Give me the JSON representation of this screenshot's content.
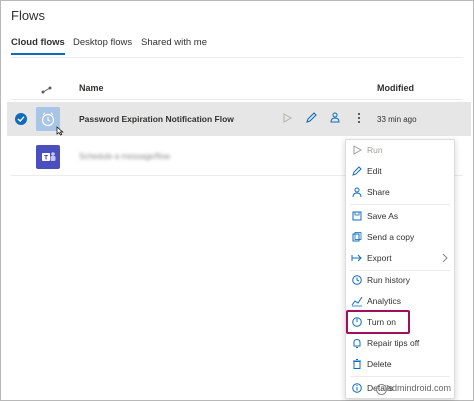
{
  "page": {
    "title": "Flows"
  },
  "tabs": [
    {
      "label": "Cloud flows",
      "active": true
    },
    {
      "label": "Desktop flows",
      "active": false
    },
    {
      "label": "Shared with me",
      "active": false
    }
  ],
  "table": {
    "headers": {
      "type_icon": "flow-type-icon",
      "name": "Name",
      "modified": "Modified"
    },
    "rows": [
      {
        "name": "Password Expiration Notification Flow",
        "modified": "33 min ago",
        "selected": true,
        "icon": "alarm-clock-icon"
      },
      {
        "name": "Schedule a message/flow",
        "modified": "",
        "selected": false,
        "icon": "teams-icon"
      }
    ]
  },
  "menu": {
    "items": [
      {
        "label": "Run",
        "icon": "play-icon",
        "disabled": true
      },
      {
        "label": "Edit",
        "icon": "pencil-icon"
      },
      {
        "label": "Share",
        "icon": "share-icon"
      },
      {
        "label": "Save As",
        "icon": "save-as-icon"
      },
      {
        "label": "Send a copy",
        "icon": "send-copy-icon"
      },
      {
        "label": "Export",
        "icon": "export-icon",
        "submenu": true
      },
      {
        "label": "Run history",
        "icon": "history-icon"
      },
      {
        "label": "Analytics",
        "icon": "analytics-icon"
      },
      {
        "label": "Turn on",
        "icon": "power-icon",
        "highlighted": true
      },
      {
        "label": "Repair tips off",
        "icon": "bell-icon"
      },
      {
        "label": "Delete",
        "icon": "trash-icon"
      },
      {
        "label": "Details",
        "icon": "info-icon"
      }
    ]
  },
  "watermark": {
    "text": "admindroid.com"
  },
  "colors": {
    "accent": "#0f6cbd",
    "highlight_border": "#a0105a",
    "selected_row": "#e6e6e6",
    "teams": "#4b4fbe",
    "alarm_tile": "#a8c4e6"
  }
}
